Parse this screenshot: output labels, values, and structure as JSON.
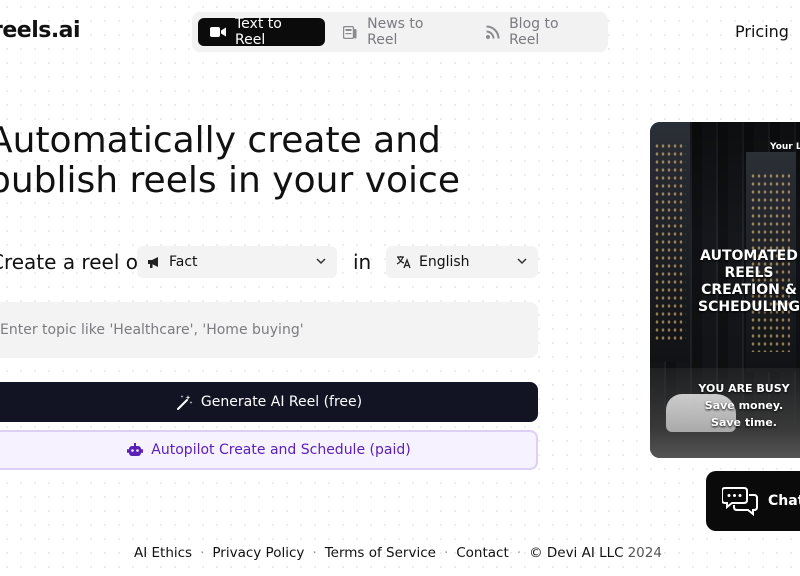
{
  "header": {
    "logo": "reels.ai",
    "tabs": [
      {
        "label": "Text to Reel",
        "icon": "video-camera-icon",
        "active": true
      },
      {
        "label": "News to Reel",
        "icon": "newspaper-icon",
        "active": false
      },
      {
        "label": "Blog to Reel",
        "icon": "rss-icon",
        "active": false
      }
    ],
    "pricing": "Pricing"
  },
  "hero": {
    "line1": "Automatically create and",
    "line2": "publish reels in your voice"
  },
  "form": {
    "create_label": "Create a reel on",
    "type_select": {
      "value": "Fact",
      "icon": "megaphone-icon"
    },
    "in_label": "in",
    "language_select": {
      "value": "English",
      "icon": "translate-icon"
    },
    "topic_placeholder": "Enter topic like 'Healthcare', 'Home buying'",
    "generate_button": "Generate AI Reel (free)",
    "autopilot_button": "Autopilot Create and Schedule (paid)"
  },
  "preview": {
    "top_text": "Your L",
    "headline": [
      "AUTOMATED",
      "REELS",
      "CREATION &",
      "SCHEDULING"
    ],
    "subline": [
      "YOU ARE BUSY",
      "Save money.",
      "Save time."
    ]
  },
  "chat": {
    "label": "Chat"
  },
  "footer": {
    "links": [
      "AI Ethics",
      "Privacy Policy",
      "Terms of Service",
      "Contact"
    ],
    "copyright": "© Devi AI LLC",
    "year": "2024"
  },
  "colors": {
    "primary_dark": "#121424",
    "autopilot_bg": "#f6f2ff",
    "autopilot_text": "#5b21b6",
    "input_bg": "#f3f3f4"
  }
}
